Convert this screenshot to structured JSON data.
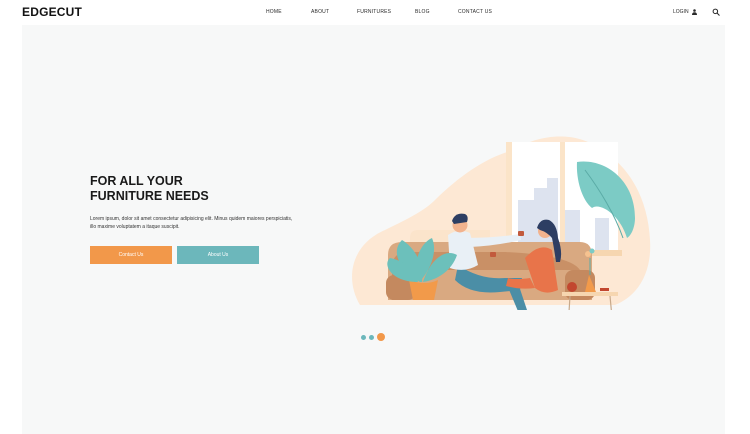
{
  "brand": {
    "name": "EDGECUT"
  },
  "nav": {
    "items": [
      {
        "label": "HOME"
      },
      {
        "label": "ABOUT"
      },
      {
        "label": "FURNITURES"
      },
      {
        "label": "BLOG"
      },
      {
        "label": "CONTACT US"
      }
    ],
    "login_label": "LOGIN",
    "login_icon": "user-icon",
    "search_icon": "search-icon"
  },
  "hero": {
    "title_line1": "FOR ALL YOUR",
    "title_line2": "FURNITURE NEEDS",
    "description": "Lorem ipsum, dolor sit amet consectetur adipisicing elit. Minus quidem maiores perspiciatis, illo maxime voluptatem a itaque suscipit.",
    "primary_button": "Contact Us",
    "secondary_button": "About Us"
  },
  "carousel": {
    "slides": 3,
    "active": 3
  },
  "colors": {
    "accent": "#f2984a",
    "teal": "#6cb7bb",
    "background": "#f7f8f8"
  }
}
